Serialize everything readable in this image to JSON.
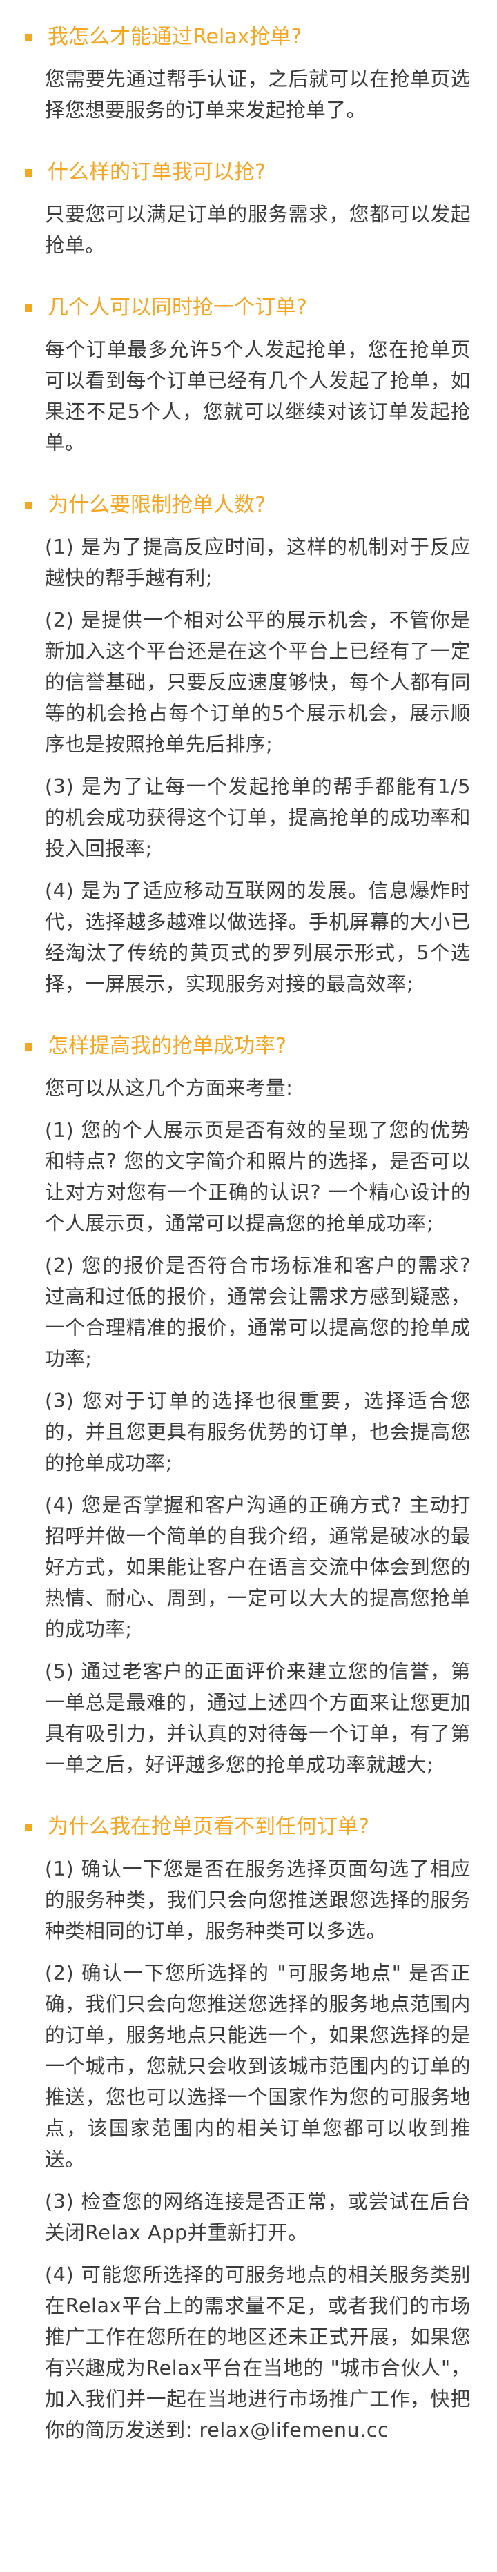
{
  "faq": [
    {
      "question": "我怎么才能通过Relax抢单?",
      "paragraphs": [
        "您需要先通过帮手认证，之后就可以在抢单页选择您想要服务的订单来发起抢单了。"
      ]
    },
    {
      "question": "什么样的订单我可以抢?",
      "paragraphs": [
        "只要您可以满足订单的服务需求，您都可以发起抢单。"
      ]
    },
    {
      "question": "几个人可以同时抢一个订单?",
      "paragraphs": [
        "每个订单最多允许5个人发起抢单，您在抢单页可以看到每个订单已经有几个人发起了抢单，如果还不足5个人，您就可以继续对该订单发起抢单。"
      ]
    },
    {
      "question": "为什么要限制抢单人数?",
      "paragraphs": [
        "(1) 是为了提高反应时间，这样的机制对于反应越快的帮手越有利;",
        "(2) 是提供一个相对公平的展示机会，不管你是新加入这个平台还是在这个平台上已经有了一定的信誉基础，只要反应速度够快，每个人都有同等的机会抢占每个订单的5个展示机会，展示顺序也是按照抢单先后排序;",
        "(3) 是为了让每一个发起抢单的帮手都能有1/5的机会成功获得这个订单，提高抢单的成功率和投入回报率;",
        "(4) 是为了适应移动互联网的发展。信息爆炸时代，选择越多越难以做选择。手机屏幕的大小已经淘汰了传统的黄页式的罗列展示形式，5个选择，一屏展示，实现服务对接的最高效率;"
      ]
    },
    {
      "question": "怎样提高我的抢单成功率?",
      "paragraphs": [
        "您可以从这几个方面来考量:",
        "(1) 您的个人展示页是否有效的呈现了您的优势和特点? 您的文字简介和照片的选择，是否可以让对方对您有一个正确的认识? 一个精心设计的个人展示页，通常可以提高您的抢单成功率;",
        "(2) 您的报价是否符合市场标准和客户的需求? 过高和过低的报价，通常会让需求方感到疑惑，一个合理精准的报价，通常可以提高您的抢单成功率;",
        "(3) 您对于订单的选择也很重要，选择适合您的，并且您更具有服务优势的订单，也会提高您的抢单成功率;",
        "(4) 您是否掌握和客户沟通的正确方式? 主动打招呼并做一个简单的自我介绍，通常是破冰的最好方式，如果能让客户在语言交流中体会到您的热情、耐心、周到，一定可以大大的提高您抢单的成功率;",
        "(5) 通过老客户的正面评价来建立您的信誉，第一单总是最难的，通过上述四个方面来让您更加具有吸引力，并认真的对待每一个订单，有了第一单之后，好评越多您的抢单成功率就越大;"
      ]
    },
    {
      "question": "为什么我在抢单页看不到任何订单?",
      "paragraphs": [
        "(1) 确认一下您是否在服务选择页面勾选了相应的服务种类，我们只会向您推送跟您选择的服务种类相同的订单，服务种类可以多选。",
        "(2) 确认一下您所选择的 \"可服务地点\" 是否正确，我们只会向您推送您选择的服务地点范围内的订单，服务地点只能选一个，如果您选择的是一个城市，您就只会收到该城市范围内的订单的推送，您也可以选择一个国家作为您的可服务地点，该国家范围内的相关订单您都可以收到推送。",
        "(3) 检查您的网络连接是否正常，或尝试在后台关闭Relax App并重新打开。",
        "(4) 可能您所选择的可服务地点的相关服务类别在Relax平台上的需求量不足，或者我们的市场推广工作在您所在的地区还未正式开展，如果您有兴趣成为Relax平台在当地的 \"城市合伙人\"，加入我们并一起在当地进行市场推广工作，快把你的简历发送到: relax@lifemenu.cc"
      ]
    }
  ],
  "colors": {
    "accent": "#f5a623",
    "body_text": "#3c3c3c",
    "background": "#ffffff"
  }
}
